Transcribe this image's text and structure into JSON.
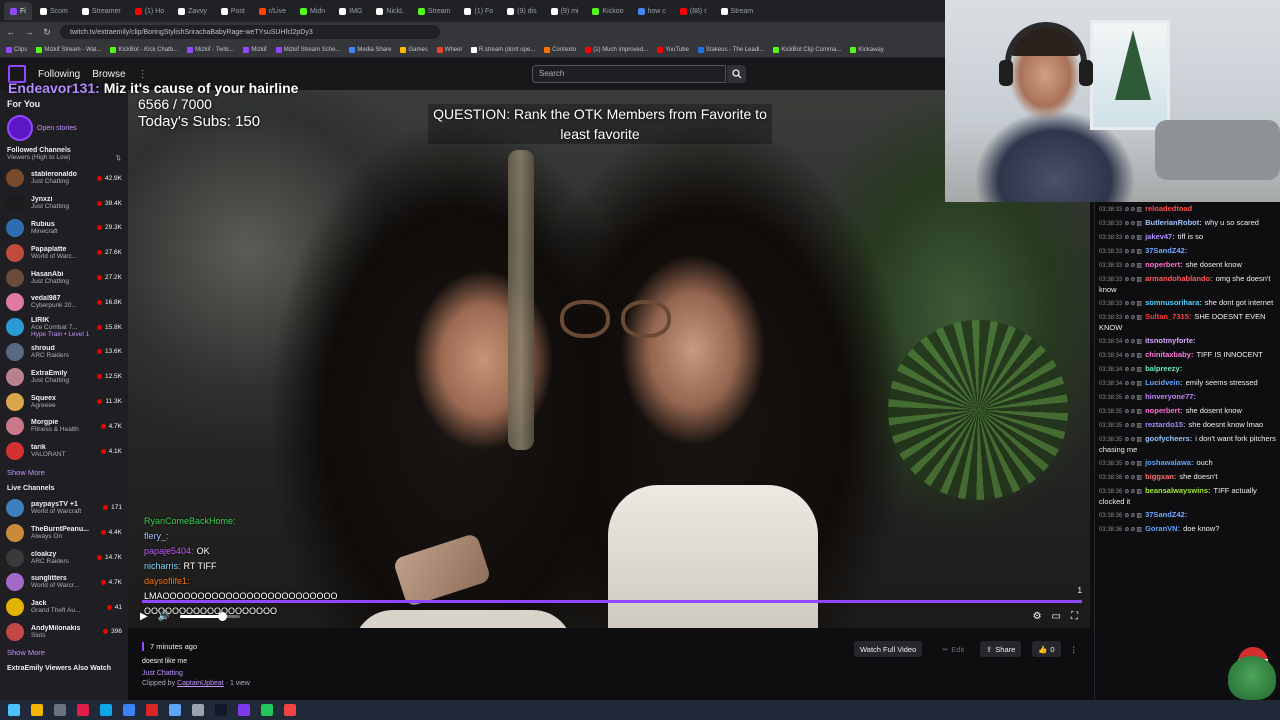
{
  "browser": {
    "tabs": [
      {
        "label": "Fi",
        "color": "#9147ff",
        "active": true
      },
      {
        "label": "Scom",
        "color": "#ffffff"
      },
      {
        "label": "Streamer",
        "color": "#ffffff"
      },
      {
        "label": "(1) Ho",
        "color": "#ff0000"
      },
      {
        "label": "Zavvy",
        "color": "#ffffff"
      },
      {
        "label": "Post",
        "color": "#ffffff"
      },
      {
        "label": "r/Live",
        "color": "#ff4500"
      },
      {
        "label": "Midn",
        "color": "#53fc18"
      },
      {
        "label": "IMG",
        "color": "#ffffff"
      },
      {
        "label": "NickL",
        "color": "#ffffff"
      },
      {
        "label": "Stream",
        "color": "#53fc18"
      },
      {
        "label": "(1) Fo",
        "color": "#ffffff"
      },
      {
        "label": "(9) dis",
        "color": "#ffffff"
      },
      {
        "label": "(9) mi",
        "color": "#ffffff"
      },
      {
        "label": "Kickoo",
        "color": "#53fc18"
      },
      {
        "label": "how c",
        "color": "#4285f4"
      },
      {
        "label": "(88) r",
        "color": "#ff0000"
      },
      {
        "label": "Stream",
        "color": "#ffffff"
      }
    ],
    "url": "twitch.tv/extraemily/clip/BoringStylishSrirachaBabyRage-weTYsuSUHfcl2pDy3",
    "bookmarks": [
      {
        "label": "Clips",
        "color": "#9147ff"
      },
      {
        "label": "Mizkif Stream - Wat...",
        "color": "#53fc18"
      },
      {
        "label": "KickBot - Kick Chatb...",
        "color": "#53fc18"
      },
      {
        "label": "Mizkif - Twitc...",
        "color": "#9147ff"
      },
      {
        "label": "Mizkif",
        "color": "#9147ff"
      },
      {
        "label": "Mizkif Stream Sche...",
        "color": "#9147ff"
      },
      {
        "label": "Media Share",
        "color": "#4285f4"
      },
      {
        "label": "Games",
        "color": "#fbbc04"
      },
      {
        "label": "Wheel",
        "color": "#ea4335"
      },
      {
        "label": "R.stream (dont ope...",
        "color": "#ffffff"
      },
      {
        "label": "Contexto",
        "color": "#ff6d00"
      },
      {
        "label": "(1) Much improved...",
        "color": "#ff0000"
      },
      {
        "label": "YouTube",
        "color": "#ff0000"
      },
      {
        "label": "Stakeus - The Leadi...",
        "color": "#1a73e8"
      },
      {
        "label": "KickBot Clip Comma...",
        "color": "#53fc18"
      },
      {
        "label": "Kickaway",
        "color": "#53fc18"
      }
    ]
  },
  "topnav": {
    "following": "Following",
    "browse": "Browse",
    "more": "⋮",
    "search_placeholder": "Search"
  },
  "sidebar": {
    "for_you": "For You",
    "stories_label": "Open stories",
    "followed_title": "Followed Channels",
    "followed_sub": "Viewers (High to Low)",
    "followed": [
      {
        "name": "stableronaldo",
        "game": "Just Chatting",
        "viewers": "42.9K",
        "color": "#7a4b2a"
      },
      {
        "name": "Jynxzi",
        "game": "Just Chatting",
        "viewers": "39.4K",
        "color": "#1c1c1c"
      },
      {
        "name": "Rubius",
        "game": "Minecraft",
        "viewers": "29.3K",
        "color": "#2f6db3"
      },
      {
        "name": "Papaplatte",
        "game": "World of Warc...",
        "viewers": "27.6K",
        "color": "#c04a3b"
      },
      {
        "name": "HasanAbi",
        "game": "Just Chatting",
        "viewers": "27.2K",
        "color": "#6b4b3c"
      },
      {
        "name": "vedal987",
        "game": "Cyberpunk 20...",
        "viewers": "16.8K",
        "color": "#e07aa5"
      },
      {
        "name": "LIRIK",
        "game": "Ace Combat 7...",
        "viewers": "15.8K",
        "extra": "Hype Train • Level 1",
        "color": "#2b9bd6"
      },
      {
        "name": "shroud",
        "game": "ARC Raiders",
        "viewers": "13.6K",
        "color": "#5a6a86"
      },
      {
        "name": "ExtraEmily",
        "game": "Just Chatting",
        "viewers": "12.5K",
        "color": "#b9818e"
      },
      {
        "name": "Squeex",
        "game": "Agreeee",
        "viewers": "11.3K",
        "color": "#d9a64a"
      },
      {
        "name": "Morgpie",
        "game": "Fitness & Health",
        "viewers": "4.7K",
        "color": "#c9798a"
      },
      {
        "name": "tarik",
        "game": "VALORANT",
        "viewers": "4.1K",
        "color": "#d2312f"
      }
    ],
    "show_more_1": "Show More",
    "live_title": "Live Channels",
    "live": [
      {
        "name": "paypaysTV +1",
        "game": "World of Warcraft",
        "viewers": "171",
        "color": "#3b7fbd"
      },
      {
        "name": "TheBurntPeanu...",
        "game": "Always On",
        "viewers": "4.4K",
        "color": "#c98a3c"
      },
      {
        "name": "cloakzy",
        "game": "ARC Raiders",
        "viewers": "14.7K",
        "color": "#3a3a3a"
      },
      {
        "name": "sunglitters",
        "game": "World of Warcr...",
        "viewers": "4.7K",
        "color": "#a36ac7"
      },
      {
        "name": "Jack",
        "game": "Grand Theft Au...",
        "viewers": "41",
        "color": "#e0b400"
      },
      {
        "name": "AndyMilonakis",
        "game": "Slots",
        "viewers": "396",
        "color": "#c24747"
      }
    ],
    "show_more_2": "Show More",
    "also_watch": "ExtraEmily Viewers Also Watch"
  },
  "video": {
    "overlay_user": "Endeavor131:",
    "overlay_msg": "Miz it's cause of your hairline",
    "sub_progress": "6566 / 7000",
    "subs_today": "Today's Subs: 150",
    "question": "QUESTION: Rank the OTK Members from Favorite to least favorite",
    "chat_lines": [
      {
        "user": "RyanComeBackHome:",
        "msg": "",
        "cls": "u1"
      },
      {
        "user": "flery_:",
        "msg": "",
        "cls": "u2"
      },
      {
        "user": "papaje5404:",
        "msg": "OK",
        "cls": "u3"
      },
      {
        "user": "nicharris:",
        "msg": "RT TIFF",
        "cls": "u4"
      },
      {
        "user": "daysoflife1:",
        "msg": "",
        "cls": "u5"
      }
    ],
    "chat_lmao": "LMAOOOOOOOOOOOOOOOOOOOOOOOOO",
    "chat_lmao2": "OOOOOOOOOOOOOOOOOOO",
    "progress": 1.0,
    "volume": 0.7,
    "live_count": "1"
  },
  "clip": {
    "time_ago": "7 minutes ago",
    "title": "doesnt like me",
    "category": "Just Chatting",
    "clipped_by_prefix": "Clipped by",
    "clipper": "CaptainUpbeat",
    "views": "· 1 view",
    "watch_full": "Watch Full Video",
    "edit": "Edit",
    "share": "Share",
    "likes": "0"
  },
  "chat": [
    {
      "ts": "03:38:33",
      "user": "reloadedtoad",
      "color": "#ff4d4d",
      "msg": ""
    },
    {
      "ts": "03:38:33",
      "user": "ButlerianRobot:",
      "color": "#9fc4ff",
      "msg": "why u so scared"
    },
    {
      "ts": "03:38:33",
      "user": "jakev47:",
      "color": "#b18cff",
      "msg": "tiff is so"
    },
    {
      "ts": "03:38:33",
      "user": "37SandZ42:",
      "color": "#6fa8ff",
      "msg": ""
    },
    {
      "ts": "03:38:33",
      "user": "noperbert:",
      "color": "#ff6bd5",
      "msg": "she dosent know"
    },
    {
      "ts": "03:38:33",
      "user": "armandohablando:",
      "color": "#ff5a5a",
      "msg": "omg she doesn't know"
    },
    {
      "ts": "03:38:33",
      "user": "somnusorihara:",
      "color": "#4fd1ff",
      "msg": "she dont got internet"
    },
    {
      "ts": "03:38:33",
      "user": "Sultan_7315:",
      "color": "#ff3b3b",
      "msg": "SHE DOESNT EVEN KNOW"
    },
    {
      "ts": "03:38:34",
      "user": "itsnotmyforte:",
      "color": "#d4a5ff",
      "msg": ""
    },
    {
      "ts": "03:38:34",
      "user": "chinitaxbaby:",
      "color": "#ff7ad9",
      "msg": "TIFF IS INNOCENT"
    },
    {
      "ts": "03:38:34",
      "user": "balpreezy:",
      "color": "#6ee7b7",
      "msg": ""
    },
    {
      "ts": "03:38:34",
      "user": "Lucidvein:",
      "color": "#60a5fa",
      "msg": "emily seems stressed"
    },
    {
      "ts": "03:38:35",
      "user": "hinveryone77:",
      "color": "#c084fc",
      "msg": ""
    },
    {
      "ts": "03:38:35",
      "user": "noperbert:",
      "color": "#ff6bd5",
      "msg": "she dosent know"
    },
    {
      "ts": "03:38:35",
      "user": "reztardo15:",
      "color": "#a78bfa",
      "msg": "she doesnt know lmao"
    },
    {
      "ts": "03:38:35",
      "user": "goofycheers:",
      "color": "#93c5fd",
      "msg": "i don't want fork pitchers chasing me"
    },
    {
      "ts": "03:38:35",
      "user": "joshawalawa:",
      "color": "#60a5fa",
      "msg": "ouch"
    },
    {
      "ts": "03:38:36",
      "user": "biggxan:",
      "color": "#f87171",
      "msg": "she doesn't"
    },
    {
      "ts": "03:38:36",
      "user": "beansalwayswins:",
      "color": "#a3e635",
      "msg": "TIFF actually clocked it"
    },
    {
      "ts": "03:38:36",
      "user": "37SandZ42:",
      "color": "#6fa8ff",
      "msg": ""
    },
    {
      "ts": "03:38:36",
      "user": "GoranVN:",
      "color": "#60a5fa",
      "msg": "doe know?"
    }
  ],
  "taskbar": {
    "icons": [
      "#4cc2ff",
      "#f4b400",
      "#6b7280",
      "#e11d48",
      "#0ea5e9",
      "#3b82f6",
      "#dc2626",
      "#60a5fa",
      "#9ca3af",
      "#111827",
      "#7c3aed",
      "#22c55e",
      "#ef4444"
    ]
  }
}
